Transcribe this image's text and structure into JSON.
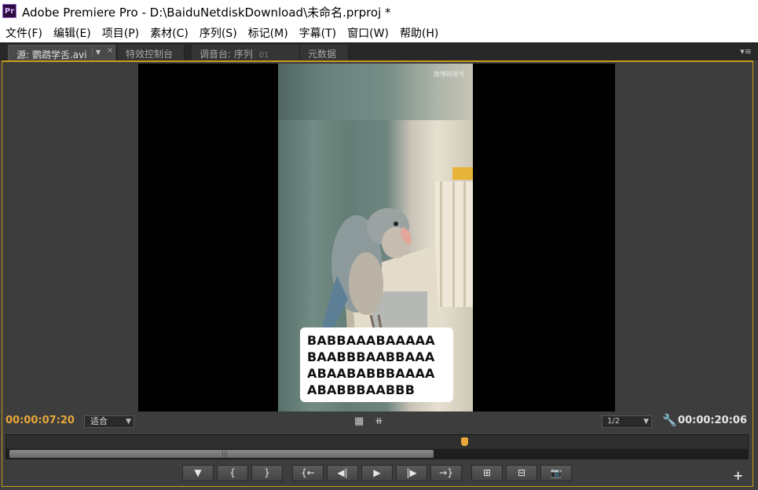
{
  "window": {
    "app_icon": "Pr",
    "title": "Adobe Premiere Pro - D:\\BaiduNetdiskDownload\\未命名.prproj *"
  },
  "menu": [
    "文件(F)",
    "编辑(E)",
    "项目(P)",
    "素材(C)",
    "序列(S)",
    "标记(M)",
    "字幕(T)",
    "窗口(W)",
    "帮助(H)"
  ],
  "tabs": [
    {
      "label": "源: 鹦鹉学舌.avi",
      "extra": ""
    },
    {
      "label": "特效控制台",
      "extra": ""
    },
    {
      "label": "调音台: 序列",
      "extra": "01"
    },
    {
      "label": "元数据",
      "extra": ""
    }
  ],
  "video": {
    "watermark": "微博视频号",
    "meme_lines": [
      "BABBAAABAAAAA",
      "BAABBBAABBAAA",
      "ABAABABBBAAAA",
      "ABABBBAABBB"
    ]
  },
  "controls": {
    "current_time": "00:00:07:20",
    "duration": "00:00:20:06",
    "fit_value": "适合",
    "resolution_value": "1/2",
    "playhead_fraction": 0.38
  },
  "icons": {
    "filmstrip": "filmstrip-icon",
    "audio_wave": "audio-waveform-icon",
    "wrench": "settings-wrench-icon"
  },
  "transport": [
    {
      "name": "set-marker-button",
      "glyph": "▼"
    },
    {
      "name": "mark-in-button",
      "glyph": "{"
    },
    {
      "name": "mark-out-button",
      "glyph": "}"
    },
    {
      "name": "go-to-in-button",
      "glyph": "{←"
    },
    {
      "name": "step-back-button",
      "glyph": "◀|"
    },
    {
      "name": "play-button",
      "glyph": "▶"
    },
    {
      "name": "step-forward-button",
      "glyph": "|▶"
    },
    {
      "name": "go-to-out-button",
      "glyph": "→}"
    },
    {
      "name": "insert-button",
      "glyph": "⊞"
    },
    {
      "name": "overlay-button",
      "glyph": "⊟"
    },
    {
      "name": "export-frame-button",
      "glyph": "📷"
    }
  ],
  "colors": {
    "accent": "#e8a73a",
    "panel_bg": "#3d3d3d",
    "active_border": "#c89c1a"
  }
}
